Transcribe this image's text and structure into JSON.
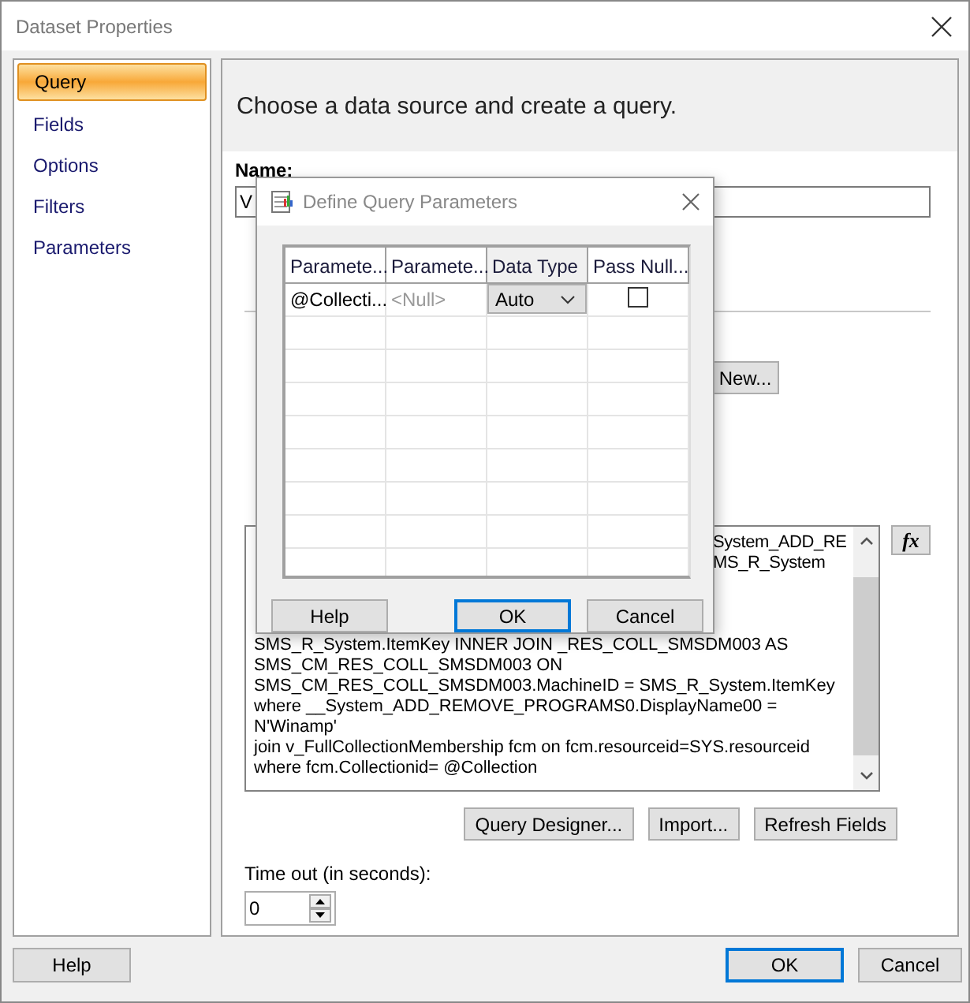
{
  "window": {
    "title": "Dataset Properties"
  },
  "sidebar": {
    "items": [
      {
        "label": "Query",
        "selected": true
      },
      {
        "label": "Fields",
        "selected": false
      },
      {
        "label": "Options",
        "selected": false
      },
      {
        "label": "Filters",
        "selected": false
      },
      {
        "label": "Parameters",
        "selected": false
      }
    ]
  },
  "header": "Choose a data source and create a query.",
  "name": {
    "label": "Name:",
    "value": "V"
  },
  "new_button": "New...",
  "query_text": {
    "lines": [
      {
        "text": "System_ADD_RE",
        "kind": "right"
      },
      {
        "text": "MS_R_System",
        "kind": "right"
      },
      {
        "text": "SMS_R_System.ItemKey  INNER JOIN _RES_COLL_SMSDM003 AS",
        "kind": "full"
      },
      {
        "text": "SMS_CM_RES_COLL_SMSDM003 ON",
        "kind": "full"
      },
      {
        "text": "SMS_CM_RES_COLL_SMSDM003.MachineID = SMS_R_System.ItemKey",
        "kind": "full"
      },
      {
        "text": "where __System_ADD_REMOVE_PROGRAMS0.DisplayName00 =",
        "kind": "full"
      },
      {
        "text": "N'Winamp'",
        "kind": "full"
      },
      {
        "text": "join v_FullCollectionMembership fcm on fcm.resourceid=SYS.resourceid",
        "kind": "full"
      },
      {
        "text": "where fcm.Collectionid= @Collection",
        "kind": "full"
      }
    ]
  },
  "fx_button": "fx",
  "action_buttons": [
    "Query Designer...",
    "Import...",
    "Refresh Fields"
  ],
  "timeout": {
    "label": "Time out (in seconds):",
    "value": "0"
  },
  "footer_buttons": [
    {
      "label": "Help",
      "default": false
    },
    {
      "label": "OK",
      "default": true
    },
    {
      "label": "Cancel",
      "default": false
    }
  ],
  "dialog": {
    "title": "Define Query Parameters",
    "columns": [
      "Paramete...",
      "Paramete...",
      "Data Type",
      "Pass Null..."
    ],
    "rows": [
      {
        "name": "@Collecti...",
        "value": "<Null>",
        "data_type": "Auto",
        "pass_null": false
      }
    ],
    "buttons": [
      {
        "label": "Help",
        "default": false
      },
      {
        "label": "OK",
        "default": true
      },
      {
        "label": "Cancel",
        "default": false
      }
    ]
  }
}
